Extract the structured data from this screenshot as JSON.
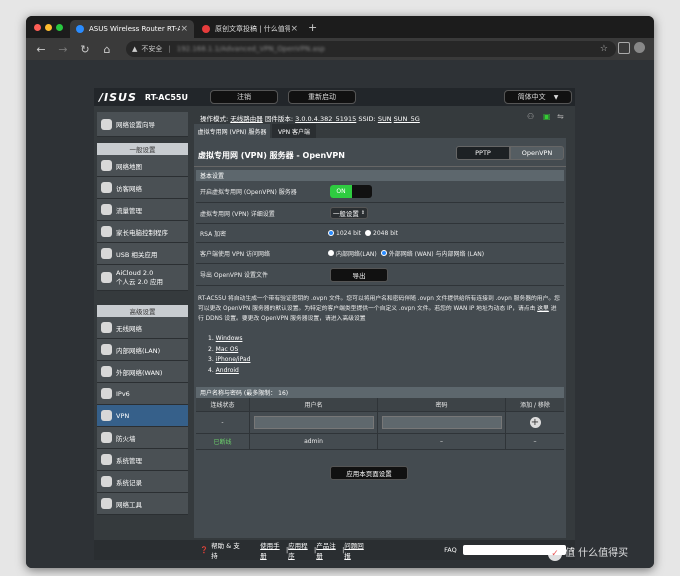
{
  "browser": {
    "tabs": [
      {
        "label": "ASUS Wireless Router RT-AC5…",
        "close": "×"
      },
      {
        "label": "原创文章投稿 | 什么值得买",
        "close": "×"
      }
    ],
    "new_tab": "+",
    "security_label": "不安全",
    "url_text": "192.168.1.1/Advanced_VPN_OpenVPN.asp"
  },
  "router": {
    "logo": "/ISUS",
    "model": "RT-AC55U",
    "logout": "注销",
    "reboot": "重新启动",
    "language": "简体中文",
    "status_prefix": "操作模式:",
    "mode": "无线路由器",
    "fw_prefix": "固件版本:",
    "firmware": "3.0.0.4.382_51915",
    "ssid_prefix": "SSID:",
    "ssid1": "SUN",
    "ssid2": "SUN_5G",
    "sidebar": {
      "quick": "网络设置向导",
      "general_header": "一般设置",
      "general": [
        "网络地图",
        "访客网络",
        "流量管理",
        "家长电脑控制程序",
        "USB 相关应用"
      ],
      "aicloud1": "AiCloud 2.0",
      "aicloud2": "个人云 2.0 应用",
      "advanced_header": "高级设置",
      "advanced": [
        "无线网络",
        "内部网络(LAN)",
        "外部网络(WAN)",
        "IPv6",
        "VPN",
        "防火墙",
        "系统管理",
        "系统记录",
        "网络工具"
      ]
    },
    "subtabs": [
      "虚拟专用网 (VPN) 服务器",
      "VPN 客户端"
    ],
    "page_title": "虚拟专用网 (VPN) 服务器 - OpenVPN",
    "type_buttons": [
      "PPTP",
      "OpenVPN"
    ],
    "basic_header": "基本设置",
    "rows": {
      "enable": "开启虚拟专用网 (OpenVPN) 服务器",
      "toggle_on": "ON",
      "detail": "虚拟专用网 (VPN) 详细设置",
      "detail_value": "一般设置",
      "rsa": "RSA 加密",
      "rsa_opt1": "1024 bit",
      "rsa_opt2": "2048 bit",
      "access": "客户端使用 VPN 访问网络",
      "access_opt1": "内部网络(LAN)",
      "access_opt2": "外部网络 (WAN) 与内部网络 (LAN)",
      "export": "导出 OpenVPN 设置文件",
      "export_btn": "导出"
    },
    "desc_1": "RT-AC55U 将自动生成一个带有验证密钥的 .ovpn 文件。您可以将用户名和密码伴随 .ovpn 文件提供给所有连接到 .ovpn 服务器的用户。您可以更改 OpenVPN 服务器的默认设置。为特定的客户端类型提供一个自定义 .ovpn 文件。若您的 WAN IP 地址为动态 IP，请点击",
    "desc_link": "这里",
    "desc_2": "进行 DDNS 设置。要更改 OpenVPN 服务器设置，请进入高级设置",
    "os_list": [
      "Windows",
      "Mac OS",
      "iPhone/iPad",
      "Android"
    ],
    "os_nums": [
      "1.",
      "2.",
      "3.",
      "4."
    ],
    "users_header": "用户名称与密码 (最多限制： 16)",
    "table_cols": [
      "连线状态",
      "用户名",
      "密码",
      "添加 / 移除"
    ],
    "new_row_status": "-",
    "user_row": {
      "status": "已断线",
      "name": "admin",
      "password": "–",
      "action": "–"
    },
    "apply": "应用本页面设置",
    "footer": {
      "help": "帮助 & 支持",
      "links": [
        "使用手册",
        "应用程序",
        "产品注册",
        "问题回报"
      ],
      "seps": [
        "|",
        "|",
        "|"
      ],
      "faq": "FAQ"
    }
  },
  "watermark": "值 什么值得买",
  "colors": {
    "active_nav": "#36608a",
    "toggle": "#2ecc40",
    "connected": "#6cd16c"
  }
}
